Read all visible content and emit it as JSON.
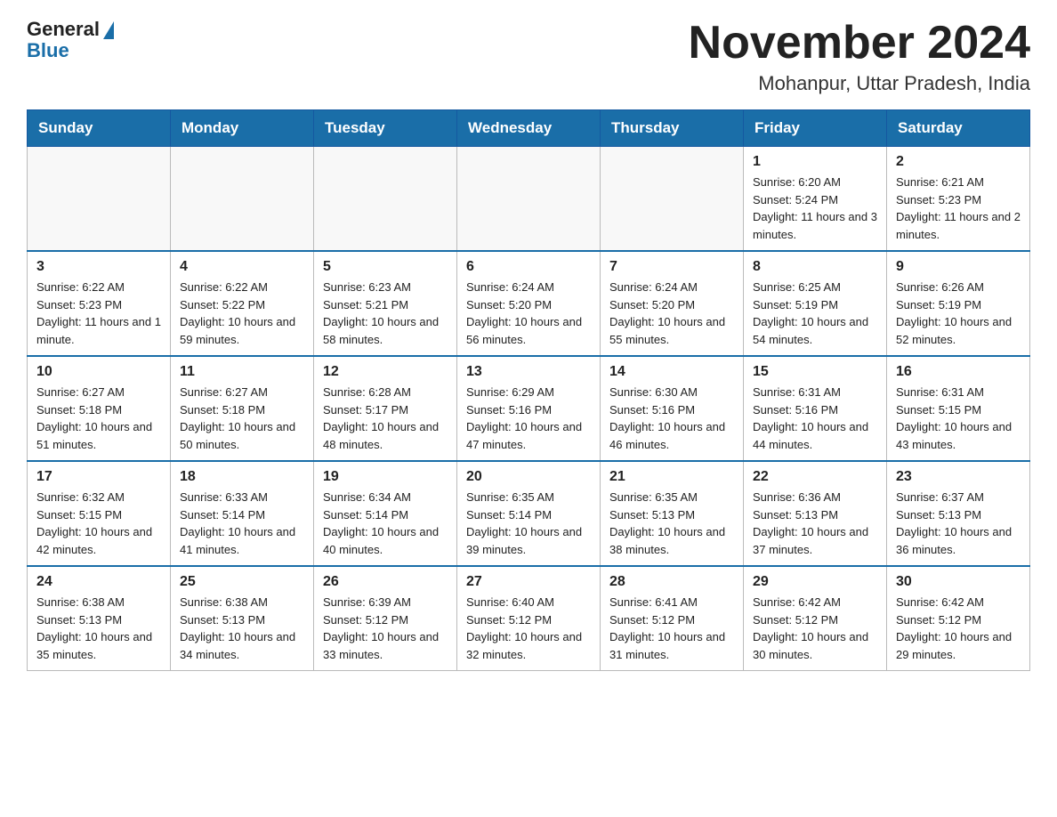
{
  "header": {
    "logo": {
      "general": "General",
      "blue": "Blue"
    },
    "title": "November 2024",
    "location": "Mohanpur, Uttar Pradesh, India"
  },
  "days_of_week": [
    "Sunday",
    "Monday",
    "Tuesday",
    "Wednesday",
    "Thursday",
    "Friday",
    "Saturday"
  ],
  "weeks": [
    [
      {
        "day": "",
        "info": ""
      },
      {
        "day": "",
        "info": ""
      },
      {
        "day": "",
        "info": ""
      },
      {
        "day": "",
        "info": ""
      },
      {
        "day": "",
        "info": ""
      },
      {
        "day": "1",
        "info": "Sunrise: 6:20 AM\nSunset: 5:24 PM\nDaylight: 11 hours and 3 minutes."
      },
      {
        "day": "2",
        "info": "Sunrise: 6:21 AM\nSunset: 5:23 PM\nDaylight: 11 hours and 2 minutes."
      }
    ],
    [
      {
        "day": "3",
        "info": "Sunrise: 6:22 AM\nSunset: 5:23 PM\nDaylight: 11 hours and 1 minute."
      },
      {
        "day": "4",
        "info": "Sunrise: 6:22 AM\nSunset: 5:22 PM\nDaylight: 10 hours and 59 minutes."
      },
      {
        "day": "5",
        "info": "Sunrise: 6:23 AM\nSunset: 5:21 PM\nDaylight: 10 hours and 58 minutes."
      },
      {
        "day": "6",
        "info": "Sunrise: 6:24 AM\nSunset: 5:20 PM\nDaylight: 10 hours and 56 minutes."
      },
      {
        "day": "7",
        "info": "Sunrise: 6:24 AM\nSunset: 5:20 PM\nDaylight: 10 hours and 55 minutes."
      },
      {
        "day": "8",
        "info": "Sunrise: 6:25 AM\nSunset: 5:19 PM\nDaylight: 10 hours and 54 minutes."
      },
      {
        "day": "9",
        "info": "Sunrise: 6:26 AM\nSunset: 5:19 PM\nDaylight: 10 hours and 52 minutes."
      }
    ],
    [
      {
        "day": "10",
        "info": "Sunrise: 6:27 AM\nSunset: 5:18 PM\nDaylight: 10 hours and 51 minutes."
      },
      {
        "day": "11",
        "info": "Sunrise: 6:27 AM\nSunset: 5:18 PM\nDaylight: 10 hours and 50 minutes."
      },
      {
        "day": "12",
        "info": "Sunrise: 6:28 AM\nSunset: 5:17 PM\nDaylight: 10 hours and 48 minutes."
      },
      {
        "day": "13",
        "info": "Sunrise: 6:29 AM\nSunset: 5:16 PM\nDaylight: 10 hours and 47 minutes."
      },
      {
        "day": "14",
        "info": "Sunrise: 6:30 AM\nSunset: 5:16 PM\nDaylight: 10 hours and 46 minutes."
      },
      {
        "day": "15",
        "info": "Sunrise: 6:31 AM\nSunset: 5:16 PM\nDaylight: 10 hours and 44 minutes."
      },
      {
        "day": "16",
        "info": "Sunrise: 6:31 AM\nSunset: 5:15 PM\nDaylight: 10 hours and 43 minutes."
      }
    ],
    [
      {
        "day": "17",
        "info": "Sunrise: 6:32 AM\nSunset: 5:15 PM\nDaylight: 10 hours and 42 minutes."
      },
      {
        "day": "18",
        "info": "Sunrise: 6:33 AM\nSunset: 5:14 PM\nDaylight: 10 hours and 41 minutes."
      },
      {
        "day": "19",
        "info": "Sunrise: 6:34 AM\nSunset: 5:14 PM\nDaylight: 10 hours and 40 minutes."
      },
      {
        "day": "20",
        "info": "Sunrise: 6:35 AM\nSunset: 5:14 PM\nDaylight: 10 hours and 39 minutes."
      },
      {
        "day": "21",
        "info": "Sunrise: 6:35 AM\nSunset: 5:13 PM\nDaylight: 10 hours and 38 minutes."
      },
      {
        "day": "22",
        "info": "Sunrise: 6:36 AM\nSunset: 5:13 PM\nDaylight: 10 hours and 37 minutes."
      },
      {
        "day": "23",
        "info": "Sunrise: 6:37 AM\nSunset: 5:13 PM\nDaylight: 10 hours and 36 minutes."
      }
    ],
    [
      {
        "day": "24",
        "info": "Sunrise: 6:38 AM\nSunset: 5:13 PM\nDaylight: 10 hours and 35 minutes."
      },
      {
        "day": "25",
        "info": "Sunrise: 6:38 AM\nSunset: 5:13 PM\nDaylight: 10 hours and 34 minutes."
      },
      {
        "day": "26",
        "info": "Sunrise: 6:39 AM\nSunset: 5:12 PM\nDaylight: 10 hours and 33 minutes."
      },
      {
        "day": "27",
        "info": "Sunrise: 6:40 AM\nSunset: 5:12 PM\nDaylight: 10 hours and 32 minutes."
      },
      {
        "day": "28",
        "info": "Sunrise: 6:41 AM\nSunset: 5:12 PM\nDaylight: 10 hours and 31 minutes."
      },
      {
        "day": "29",
        "info": "Sunrise: 6:42 AM\nSunset: 5:12 PM\nDaylight: 10 hours and 30 minutes."
      },
      {
        "day": "30",
        "info": "Sunrise: 6:42 AM\nSunset: 5:12 PM\nDaylight: 10 hours and 29 minutes."
      }
    ]
  ]
}
